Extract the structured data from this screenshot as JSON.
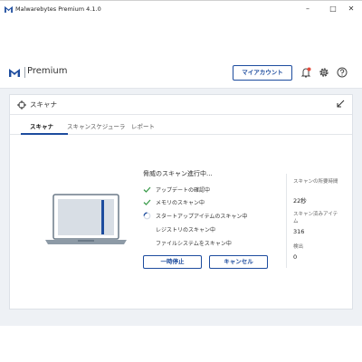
{
  "window": {
    "title": "Malwarebytes Premium  4.1.0",
    "minimize_icon": "minimize-icon",
    "maximize_icon": "maximize-icon",
    "close_icon": "close-icon"
  },
  "app": {
    "brand": "Premium",
    "account_button": "マイアカウント",
    "icons": [
      "notification-icon",
      "gear-icon",
      "help-icon"
    ],
    "accent_color": "#1d4c9e",
    "alert_color": "#e34b3c"
  },
  "panel": {
    "title": "スキャナ",
    "tabs": [
      {
        "label": "スキャナ",
        "active": true
      },
      {
        "label": "スキャンスケジューラ",
        "active": false
      },
      {
        "label": "レポート",
        "active": false
      }
    ]
  },
  "scan": {
    "status_title": "脅威のスキャン進行中...",
    "steps": [
      {
        "label": "アップデートの確認中",
        "state": "done"
      },
      {
        "label": "メモリのスキャン中",
        "state": "done"
      },
      {
        "label": "スタートアップアイテムのスキャン中",
        "state": "in-progress"
      },
      {
        "label": "レジストリのスキャン中",
        "state": "pending"
      },
      {
        "label": "ファイルシステムをスキャン中",
        "state": "pending"
      }
    ],
    "pause_button": "一時停止",
    "cancel_button": "キャンセル"
  },
  "stats": {
    "time_label": "スキャンの所要時間",
    "time_value": "22秒",
    "items_label": "スキャン済みアイテム",
    "items_value": "316",
    "detected_label": "検出",
    "detected_value": "0"
  }
}
